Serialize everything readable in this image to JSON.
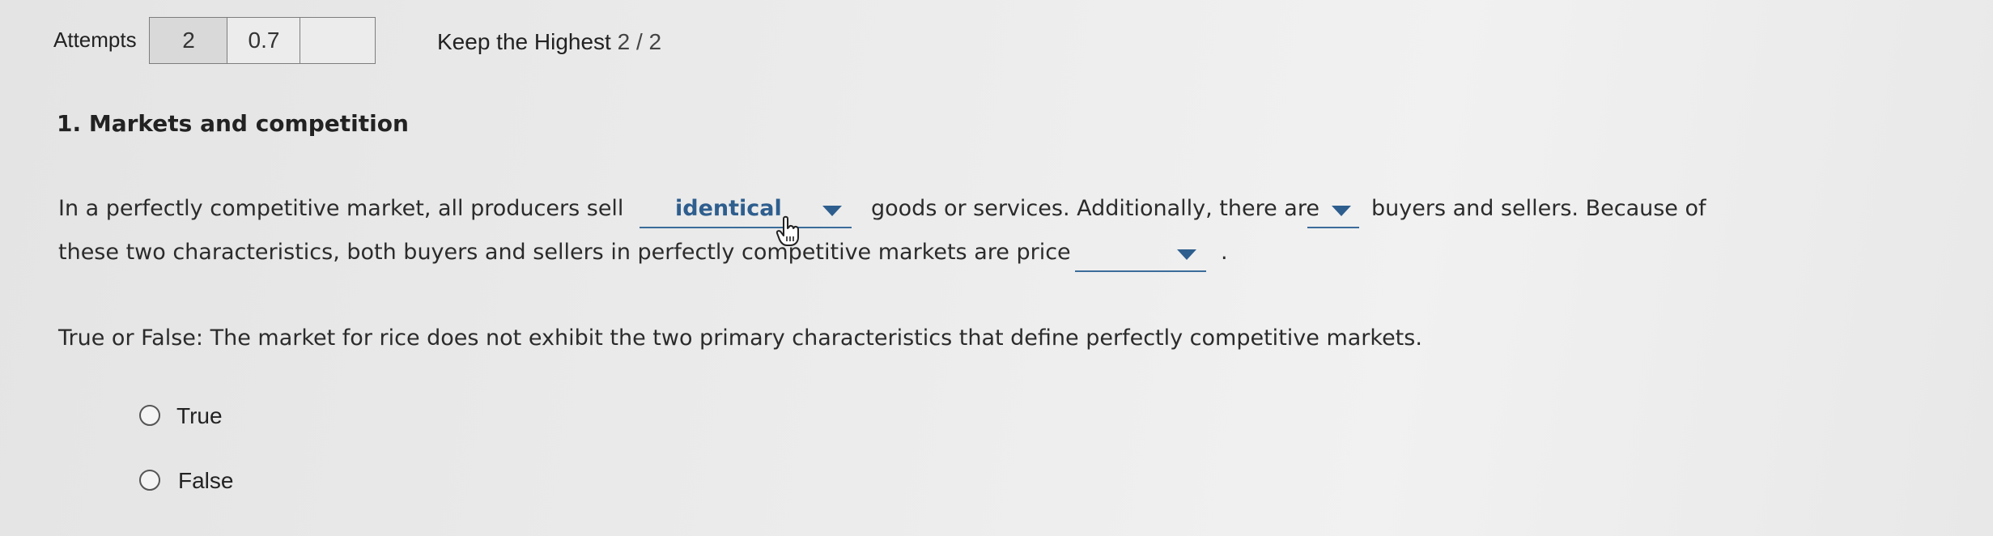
{
  "header": {
    "attempts_label": "Attempts",
    "attempts_value": "2",
    "score_value": "0.7",
    "empty_box": "",
    "keep_label": "Keep the Highest",
    "keep_score": "2 / 2"
  },
  "question": {
    "title": "1. Markets and competition",
    "line1_part1": "In a perfectly competitive market, all producers sell",
    "dropdown1_value": "identical",
    "line1_part2": "goods or services. Additionally, there are",
    "dropdown2_value": "",
    "line1_part3": "buyers and sellers. Because of",
    "line2_part1": "these two characteristics, both buyers and sellers in perfectly competitive markets are price",
    "dropdown3_value": "",
    "line2_end": ".",
    "tf_prompt": "True or False: The market for rice does not exhibit the two primary characteristics that define perfectly competitive markets.",
    "options": [
      "True",
      "False"
    ]
  },
  "colors": {
    "accent": "#2e5e8e"
  },
  "icons": [
    "chevron-down-icon",
    "hand-pointer-cursor-icon",
    "radio-icon"
  ]
}
